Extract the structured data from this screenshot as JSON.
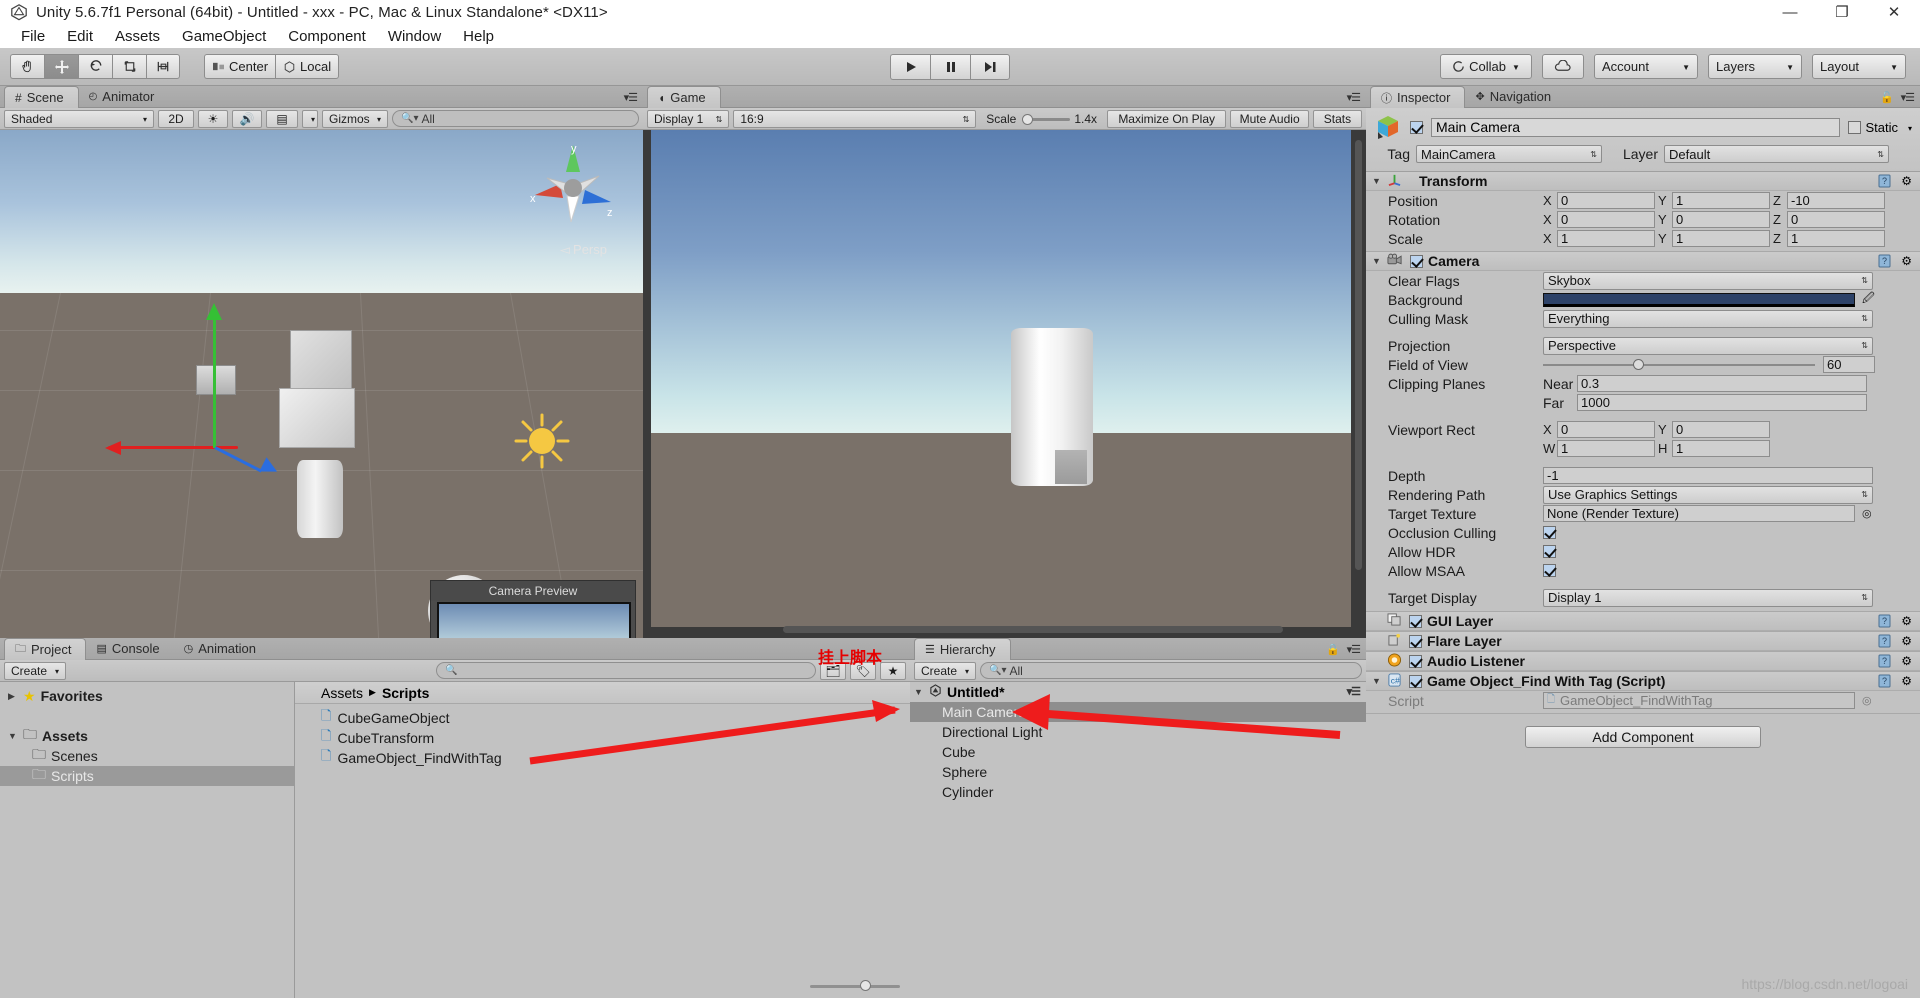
{
  "window": {
    "title": "Unity 5.6.7f1 Personal (64bit) - Untitled - xxx - PC, Mac & Linux Standalone* <DX11>",
    "minimize": "—",
    "maximize": "❐",
    "close": "✕"
  },
  "menubar": {
    "items": [
      "File",
      "Edit",
      "Assets",
      "GameObject",
      "Component",
      "Window",
      "Help"
    ]
  },
  "toolbar": {
    "tools": [
      "hand-tool",
      "move-tool",
      "rotate-tool",
      "rect-tool",
      "scale-tool"
    ],
    "pivot": "Center",
    "space": "Local",
    "play": "▶",
    "pause": "❙❙",
    "step": "▶❙",
    "collab": "Collab",
    "cloud": "cloud-icon",
    "account": "Account",
    "layers": "Layers",
    "layout": "Layout"
  },
  "scene": {
    "tabs": [
      "Scene",
      "Animator"
    ],
    "active_tab": "Scene",
    "shading": "Shaded",
    "mode2d": "2D",
    "gizmos": "Gizmos",
    "search_placeholder": "All",
    "persp_label": "Persp",
    "axis_x": "x",
    "axis_y": "y",
    "axis_z": "z",
    "camera_preview_title": "Camera Preview"
  },
  "game": {
    "tabs": [
      "Game"
    ],
    "active_tab": "Game",
    "display": "Display 1",
    "aspect": "16:9",
    "scale_label": "Scale",
    "scale_value": "1.4x",
    "maximize_on_play": "Maximize On Play",
    "mute_audio": "Mute Audio",
    "stats": "Stats"
  },
  "project": {
    "tabs": [
      "Project",
      "Console",
      "Animation"
    ],
    "active_tab": "Project",
    "create_label": "Create",
    "search_placeholder": "",
    "tree": [
      {
        "label": "Favorites",
        "icon": "star-icon",
        "expandable": true,
        "expanded": false,
        "depth": 0,
        "selected": false
      },
      {
        "label": "Assets",
        "icon": "folder-icon",
        "expandable": true,
        "expanded": true,
        "depth": 0,
        "selected": false
      },
      {
        "label": "Scenes",
        "icon": "folder-icon",
        "expandable": false,
        "expanded": false,
        "depth": 1,
        "selected": false
      },
      {
        "label": "Scripts",
        "icon": "folder-icon",
        "expandable": false,
        "expanded": false,
        "depth": 1,
        "selected": true
      }
    ],
    "breadcrumb": [
      "Assets",
      "Scripts"
    ],
    "assets": [
      {
        "name": "CubeGameObject",
        "icon": "csharp-script-icon"
      },
      {
        "name": "CubeTransform",
        "icon": "csharp-script-icon"
      },
      {
        "name": "GameObject_FindWithTag",
        "icon": "csharp-script-icon"
      }
    ]
  },
  "hierarchy": {
    "tabs": [
      "Hierarchy"
    ],
    "active_tab": "Hierarchy",
    "create_label": "Create",
    "search_placeholder": "All",
    "scene_name": "Untitled*",
    "items": [
      {
        "label": "Main Camera",
        "selected": true
      },
      {
        "label": "Directional Light",
        "selected": false
      },
      {
        "label": "Cube",
        "selected": false
      },
      {
        "label": "Sphere",
        "selected": false
      },
      {
        "label": "Cylinder",
        "selected": false
      }
    ]
  },
  "inspector": {
    "tabs": [
      "Inspector",
      "Navigation"
    ],
    "active_tab": "Inspector",
    "object_name": "Main Camera",
    "object_enabled": true,
    "static_label": "Static",
    "tag_label": "Tag",
    "tag_value": "MainCamera",
    "layer_label": "Layer",
    "layer_value": "Default",
    "transform": {
      "title": "Transform",
      "rows": [
        {
          "name": "Position",
          "x": "0",
          "y": "1",
          "z": "-10"
        },
        {
          "name": "Rotation",
          "x": "0",
          "y": "0",
          "z": "0"
        },
        {
          "name": "Scale",
          "x": "1",
          "y": "1",
          "z": "1"
        }
      ]
    },
    "camera": {
      "title": "Camera",
      "enabled": true,
      "clear_flags_label": "Clear Flags",
      "clear_flags_value": "Skybox",
      "background_label": "Background",
      "background_color": "#2d4268",
      "culling_mask_label": "Culling Mask",
      "culling_mask_value": "Everything",
      "projection_label": "Projection",
      "projection_value": "Perspective",
      "fov_label": "Field of View",
      "fov_value": "60",
      "clipping_label": "Clipping Planes",
      "near_label": "Near",
      "near_value": "0.3",
      "far_label": "Far",
      "far_value": "1000",
      "viewport_label": "Viewport Rect",
      "viewport_x": "0",
      "viewport_y": "0",
      "viewport_w": "1",
      "viewport_h": "1",
      "depth_label": "Depth",
      "depth_value": "-1",
      "rendering_path_label": "Rendering Path",
      "rendering_path_value": "Use Graphics Settings",
      "target_texture_label": "Target Texture",
      "target_texture_value": "None (Render Texture)",
      "occlusion_label": "Occlusion Culling",
      "occlusion_checked": true,
      "hdr_label": "Allow HDR",
      "hdr_checked": true,
      "msaa_label": "Allow MSAA",
      "msaa_checked": true,
      "target_display_label": "Target Display",
      "target_display_value": "Display 1"
    },
    "components": [
      {
        "title": "GUI Layer",
        "icon": "gui-layer-icon",
        "enabled": true
      },
      {
        "title": "Flare Layer",
        "icon": "flare-layer-icon",
        "enabled": true
      },
      {
        "title": "Audio Listener",
        "icon": "audio-listener-icon",
        "enabled": true
      }
    ],
    "script_component": {
      "title": "Game Object_Find With Tag (Script)",
      "enabled": true,
      "script_label": "Script",
      "script_value": "GameObject_FindWithTag"
    },
    "add_component": "Add Component"
  },
  "annotations": {
    "attach_script": "挂上脚本"
  },
  "watermark": "https://blog.csdn.net/logoai"
}
